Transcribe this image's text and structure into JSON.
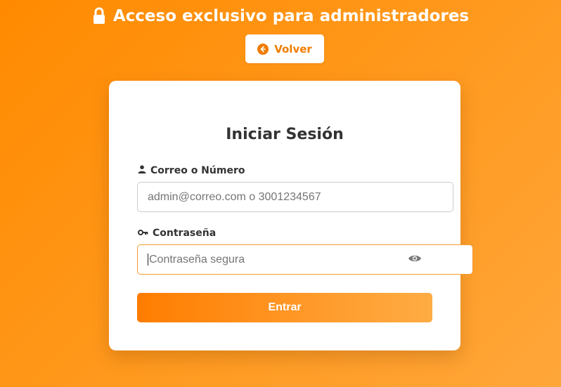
{
  "header": {
    "title": "Acceso exclusivo para administradores",
    "title_icon": "lock-icon",
    "back_label": "Volver",
    "back_icon": "arrow-left-circle-icon"
  },
  "login": {
    "title": "Iniciar Sesión",
    "email_label": "Correo o Número",
    "email_icon": "user-icon",
    "email_placeholder": "admin@correo.com o 3001234567",
    "password_label": "Contraseña",
    "password_icon": "key-icon",
    "password_placeholder": "Contraseña segura",
    "toggle_icon": "eye-icon",
    "submit_label": "Entrar"
  },
  "colors": {
    "accent": "#ff8a00",
    "text": "#333333",
    "background_card": "#ffffff"
  }
}
